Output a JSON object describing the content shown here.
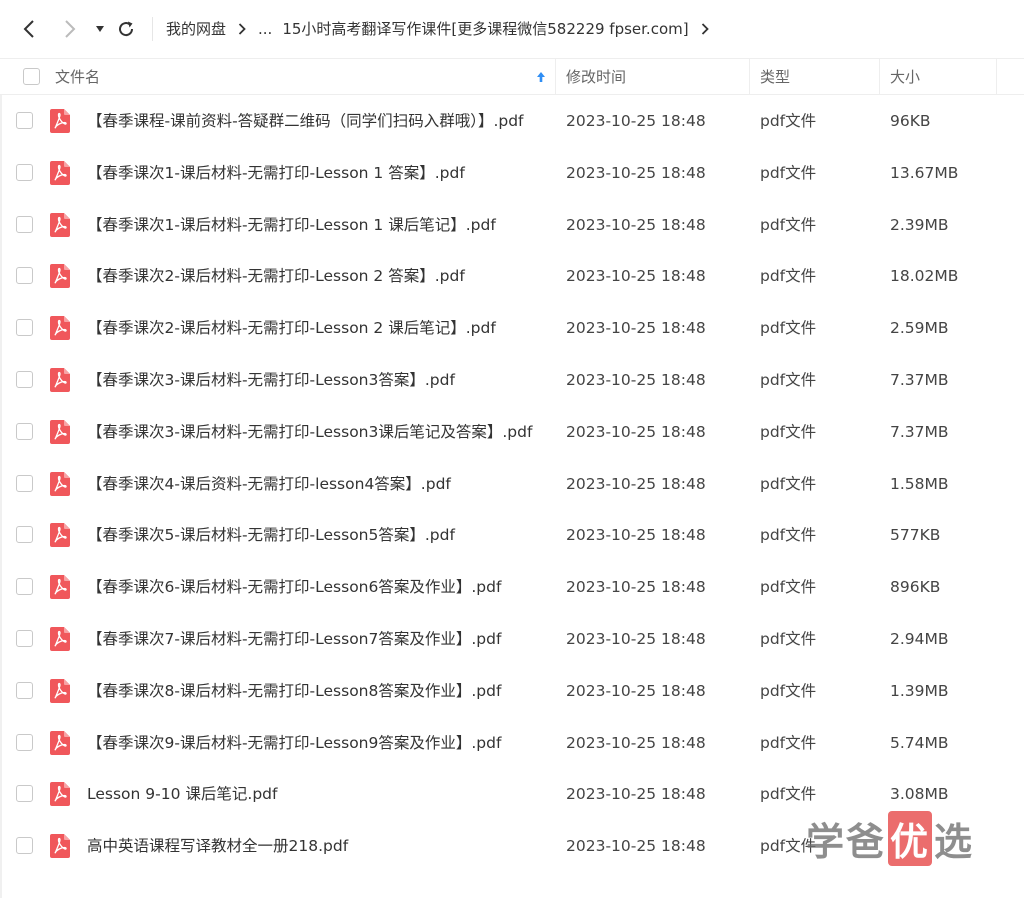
{
  "toolbar": {
    "back_icon": "chevron-left-icon",
    "forward_icon": "chevron-right-icon",
    "history_icon": "caret-down-icon",
    "refresh_icon": "refresh-icon"
  },
  "breadcrumb": {
    "root": "我的网盘",
    "ellipsis": "...",
    "current": "15小时高考翻译写作课件[更多课程微信582229 fpser.com]"
  },
  "columns": {
    "name": "文件名",
    "modified": "修改时间",
    "type": "类型",
    "size": "大小",
    "sort_icon": "sort-up-arrow-icon"
  },
  "files": [
    {
      "name": "【春季课程-课前资料-答疑群二维码（同学们扫码入群哦）】.pdf",
      "modified": "2023-10-25 18:48",
      "type": "pdf文件",
      "size": "96KB"
    },
    {
      "name": "【春季课次1-课后材料-无需打印-Lesson 1 答案】.pdf",
      "modified": "2023-10-25 18:48",
      "type": "pdf文件",
      "size": "13.67MB"
    },
    {
      "name": "【春季课次1-课后材料-无需打印-Lesson 1 课后笔记】.pdf",
      "modified": "2023-10-25 18:48",
      "type": "pdf文件",
      "size": "2.39MB"
    },
    {
      "name": "【春季课次2-课后材料-无需打印-Lesson 2 答案】.pdf",
      "modified": "2023-10-25 18:48",
      "type": "pdf文件",
      "size": "18.02MB"
    },
    {
      "name": "【春季课次2-课后材料-无需打印-Lesson 2 课后笔记】.pdf",
      "modified": "2023-10-25 18:48",
      "type": "pdf文件",
      "size": "2.59MB"
    },
    {
      "name": "【春季课次3-课后材料-无需打印-Lesson3答案】.pdf",
      "modified": "2023-10-25 18:48",
      "type": "pdf文件",
      "size": "7.37MB"
    },
    {
      "name": "【春季课次3-课后材料-无需打印-Lesson3课后笔记及答案】.pdf",
      "modified": "2023-10-25 18:48",
      "type": "pdf文件",
      "size": "7.37MB"
    },
    {
      "name": "【春季课次4-课后资料-无需打印-lesson4答案】.pdf",
      "modified": "2023-10-25 18:48",
      "type": "pdf文件",
      "size": "1.58MB"
    },
    {
      "name": "【春季课次5-课后材料-无需打印-Lesson5答案】.pdf",
      "modified": "2023-10-25 18:48",
      "type": "pdf文件",
      "size": "577KB"
    },
    {
      "name": "【春季课次6-课后材料-无需打印-Lesson6答案及作业】.pdf",
      "modified": "2023-10-25 18:48",
      "type": "pdf文件",
      "size": "896KB"
    },
    {
      "name": "【春季课次7-课后材料-无需打印-Lesson7答案及作业】.pdf",
      "modified": "2023-10-25 18:48",
      "type": "pdf文件",
      "size": "2.94MB"
    },
    {
      "name": "【春季课次8-课后材料-无需打印-Lesson8答案及作业】.pdf",
      "modified": "2023-10-25 18:48",
      "type": "pdf文件",
      "size": "1.39MB"
    },
    {
      "name": "【春季课次9-课后材料-无需打印-Lesson9答案及作业】.pdf",
      "modified": "2023-10-25 18:48",
      "type": "pdf文件",
      "size": "5.74MB"
    },
    {
      "name": "Lesson 9-10 课后笔记.pdf",
      "modified": "2023-10-25 18:48",
      "type": "pdf文件",
      "size": "3.08MB"
    },
    {
      "name": "高中英语课程写译教材全一册218.pdf",
      "modified": "2023-10-25 18:48",
      "type": "pdf文件",
      "size": ""
    }
  ],
  "file_icon": "pdf-file-icon",
  "colors": {
    "pdf_icon": "#f0575b",
    "sort_arrow": "#2f8ef4",
    "watermark_highlight": "#e85454"
  },
  "watermark": {
    "part1": "学爸",
    "highlight": "优",
    "part2": "选"
  }
}
